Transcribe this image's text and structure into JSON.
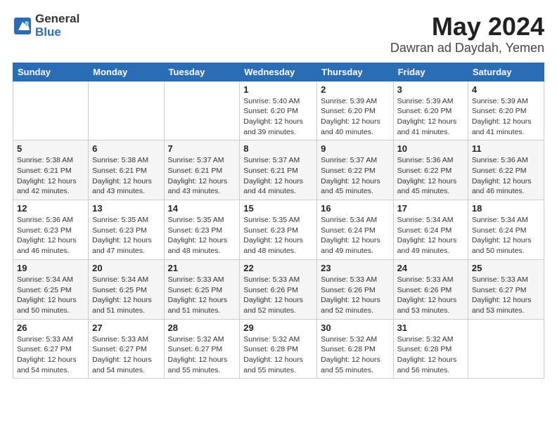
{
  "header": {
    "logo_general": "General",
    "logo_blue": "Blue",
    "title": "May 2024",
    "subtitle": "Dawran ad Daydah, Yemen"
  },
  "weekdays": [
    "Sunday",
    "Monday",
    "Tuesday",
    "Wednesday",
    "Thursday",
    "Friday",
    "Saturday"
  ],
  "weeks": [
    [
      {
        "day": "",
        "detail": ""
      },
      {
        "day": "",
        "detail": ""
      },
      {
        "day": "",
        "detail": ""
      },
      {
        "day": "1",
        "detail": "Sunrise: 5:40 AM\nSunset: 6:20 PM\nDaylight: 12 hours\nand 39 minutes."
      },
      {
        "day": "2",
        "detail": "Sunrise: 5:39 AM\nSunset: 6:20 PM\nDaylight: 12 hours\nand 40 minutes."
      },
      {
        "day": "3",
        "detail": "Sunrise: 5:39 AM\nSunset: 6:20 PM\nDaylight: 12 hours\nand 41 minutes."
      },
      {
        "day": "4",
        "detail": "Sunrise: 5:39 AM\nSunset: 6:20 PM\nDaylight: 12 hours\nand 41 minutes."
      }
    ],
    [
      {
        "day": "5",
        "detail": "Sunrise: 5:38 AM\nSunset: 6:21 PM\nDaylight: 12 hours\nand 42 minutes."
      },
      {
        "day": "6",
        "detail": "Sunrise: 5:38 AM\nSunset: 6:21 PM\nDaylight: 12 hours\nand 43 minutes."
      },
      {
        "day": "7",
        "detail": "Sunrise: 5:37 AM\nSunset: 6:21 PM\nDaylight: 12 hours\nand 43 minutes."
      },
      {
        "day": "8",
        "detail": "Sunrise: 5:37 AM\nSunset: 6:21 PM\nDaylight: 12 hours\nand 44 minutes."
      },
      {
        "day": "9",
        "detail": "Sunrise: 5:37 AM\nSunset: 6:22 PM\nDaylight: 12 hours\nand 45 minutes."
      },
      {
        "day": "10",
        "detail": "Sunrise: 5:36 AM\nSunset: 6:22 PM\nDaylight: 12 hours\nand 45 minutes."
      },
      {
        "day": "11",
        "detail": "Sunrise: 5:36 AM\nSunset: 6:22 PM\nDaylight: 12 hours\nand 46 minutes."
      }
    ],
    [
      {
        "day": "12",
        "detail": "Sunrise: 5:36 AM\nSunset: 6:23 PM\nDaylight: 12 hours\nand 46 minutes."
      },
      {
        "day": "13",
        "detail": "Sunrise: 5:35 AM\nSunset: 6:23 PM\nDaylight: 12 hours\nand 47 minutes."
      },
      {
        "day": "14",
        "detail": "Sunrise: 5:35 AM\nSunset: 6:23 PM\nDaylight: 12 hours\nand 48 minutes."
      },
      {
        "day": "15",
        "detail": "Sunrise: 5:35 AM\nSunset: 6:23 PM\nDaylight: 12 hours\nand 48 minutes."
      },
      {
        "day": "16",
        "detail": "Sunrise: 5:34 AM\nSunset: 6:24 PM\nDaylight: 12 hours\nand 49 minutes."
      },
      {
        "day": "17",
        "detail": "Sunrise: 5:34 AM\nSunset: 6:24 PM\nDaylight: 12 hours\nand 49 minutes."
      },
      {
        "day": "18",
        "detail": "Sunrise: 5:34 AM\nSunset: 6:24 PM\nDaylight: 12 hours\nand 50 minutes."
      }
    ],
    [
      {
        "day": "19",
        "detail": "Sunrise: 5:34 AM\nSunset: 6:25 PM\nDaylight: 12 hours\nand 50 minutes."
      },
      {
        "day": "20",
        "detail": "Sunrise: 5:34 AM\nSunset: 6:25 PM\nDaylight: 12 hours\nand 51 minutes."
      },
      {
        "day": "21",
        "detail": "Sunrise: 5:33 AM\nSunset: 6:25 PM\nDaylight: 12 hours\nand 51 minutes."
      },
      {
        "day": "22",
        "detail": "Sunrise: 5:33 AM\nSunset: 6:26 PM\nDaylight: 12 hours\nand 52 minutes."
      },
      {
        "day": "23",
        "detail": "Sunrise: 5:33 AM\nSunset: 6:26 PM\nDaylight: 12 hours\nand 52 minutes."
      },
      {
        "day": "24",
        "detail": "Sunrise: 5:33 AM\nSunset: 6:26 PM\nDaylight: 12 hours\nand 53 minutes."
      },
      {
        "day": "25",
        "detail": "Sunrise: 5:33 AM\nSunset: 6:27 PM\nDaylight: 12 hours\nand 53 minutes."
      }
    ],
    [
      {
        "day": "26",
        "detail": "Sunrise: 5:33 AM\nSunset: 6:27 PM\nDaylight: 12 hours\nand 54 minutes."
      },
      {
        "day": "27",
        "detail": "Sunrise: 5:33 AM\nSunset: 6:27 PM\nDaylight: 12 hours\nand 54 minutes."
      },
      {
        "day": "28",
        "detail": "Sunrise: 5:32 AM\nSunset: 6:27 PM\nDaylight: 12 hours\nand 55 minutes."
      },
      {
        "day": "29",
        "detail": "Sunrise: 5:32 AM\nSunset: 6:28 PM\nDaylight: 12 hours\nand 55 minutes."
      },
      {
        "day": "30",
        "detail": "Sunrise: 5:32 AM\nSunset: 6:28 PM\nDaylight: 12 hours\nand 55 minutes."
      },
      {
        "day": "31",
        "detail": "Sunrise: 5:32 AM\nSunset: 6:28 PM\nDaylight: 12 hours\nand 56 minutes."
      },
      {
        "day": "",
        "detail": ""
      }
    ]
  ]
}
